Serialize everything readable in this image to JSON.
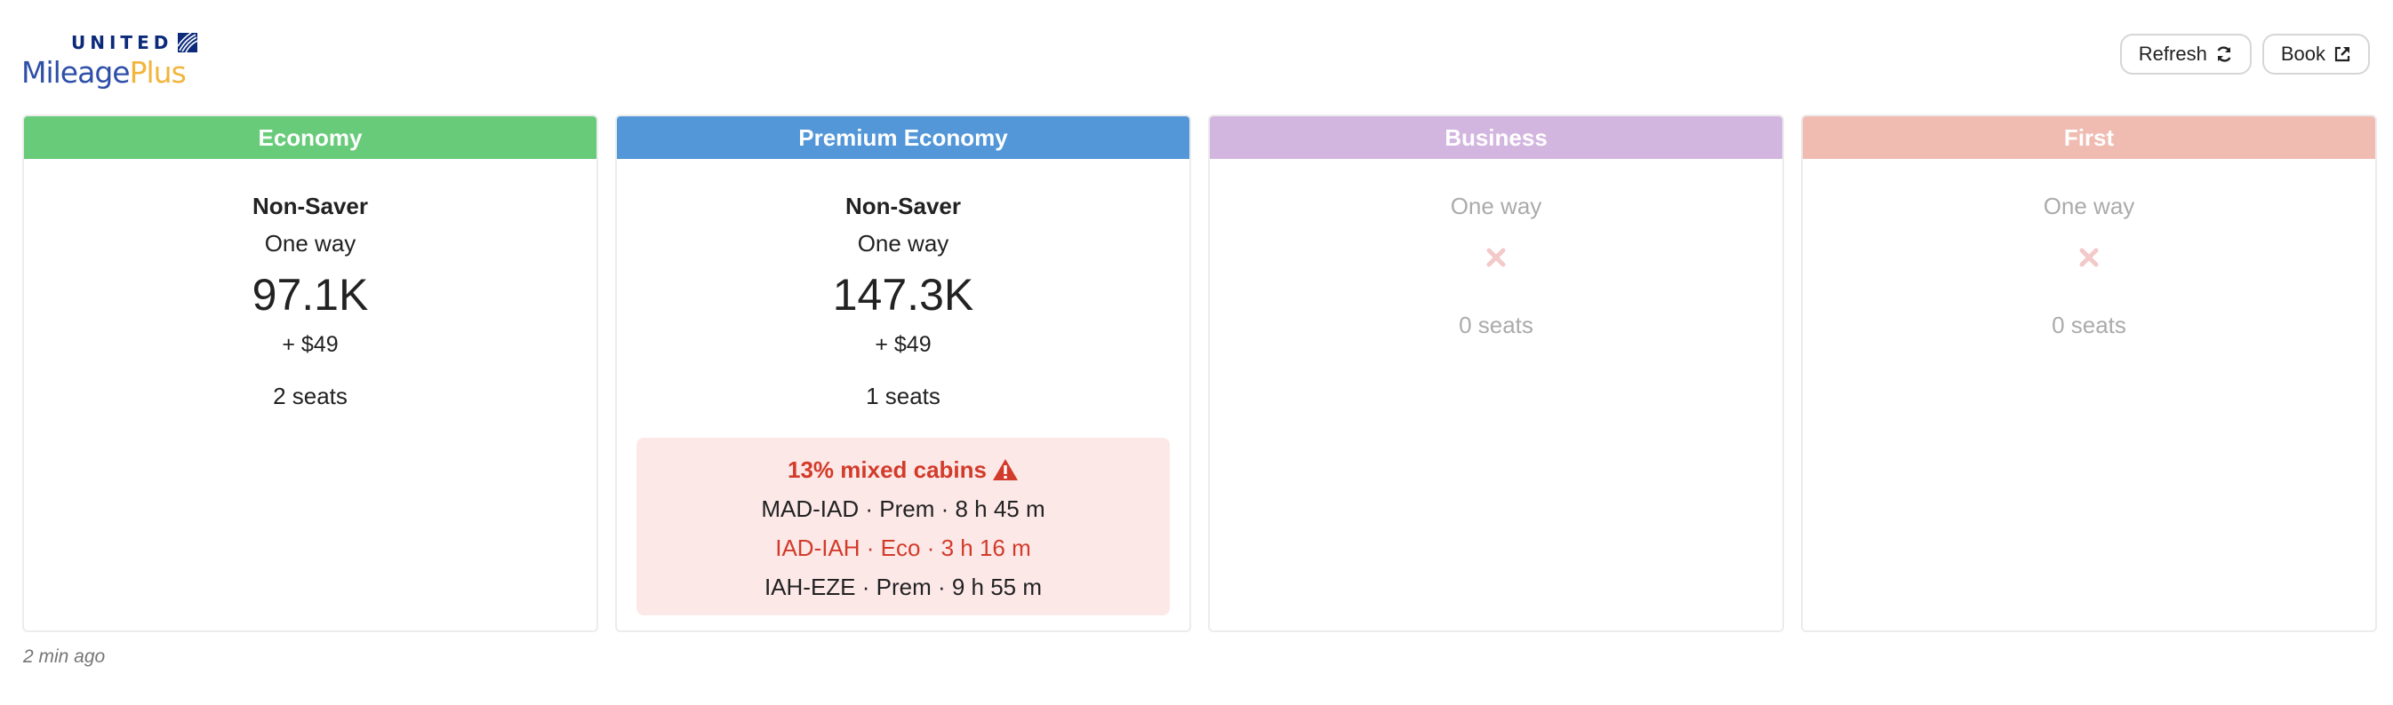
{
  "logo": {
    "united": "UNITED",
    "mileage": "Mileage",
    "plus": "Plus"
  },
  "actions": {
    "refresh_label": "Refresh",
    "book_label": "Book"
  },
  "cabins": [
    {
      "name": "Economy",
      "color": "#68cb7a",
      "fare_type": "Non-Saver",
      "trip": "One way",
      "miles": "97.1K",
      "tax": "+ $49",
      "seats": "2 seats"
    },
    {
      "name": "Premium Economy",
      "color": "#5397d8",
      "fare_type": "Non-Saver",
      "trip": "One way",
      "miles": "147.3K",
      "tax": "+ $49",
      "seats": "1 seats",
      "mixed": {
        "title": "13% mixed cabins",
        "segments": [
          "MAD-IAD · Prem · 8 h 45 m",
          "IAD-IAH · Eco · 3 h 16 m",
          "IAH-EZE · Prem · 9 h 55 m"
        ]
      }
    },
    {
      "name": "Business",
      "color": "#d3b6e0",
      "trip": "One way",
      "seats": "0 seats",
      "available": false
    },
    {
      "name": "First",
      "color": "#f0bcb2",
      "trip": "One way",
      "seats": "0 seats",
      "available": false
    }
  ],
  "updated": "2 min ago",
  "icons": {
    "refresh": "refresh-icon",
    "book": "external-link-icon",
    "unavailable": "x-icon",
    "warning": "warning-icon"
  },
  "colors": {
    "warning_text": "#d23b2a",
    "warning_bg": "#fde8e8",
    "unavailable_x": "#f3c9c9"
  }
}
